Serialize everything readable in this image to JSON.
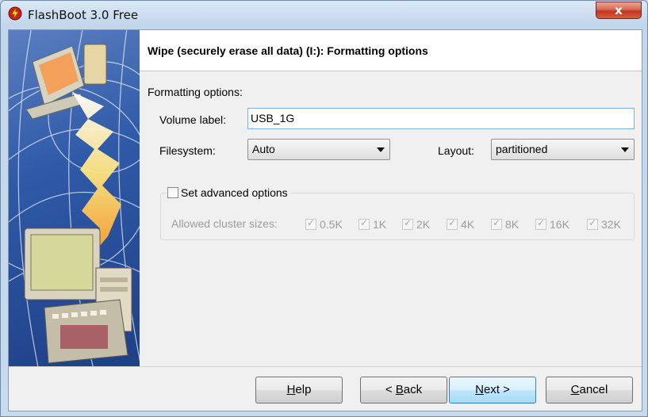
{
  "window": {
    "title": "FlashBoot 3.0 Free",
    "close_glyph": "x"
  },
  "header": {
    "title": "Wipe (securely erase all data) (I:): Formatting options"
  },
  "form": {
    "section_label": "Formatting options:",
    "volume_label": {
      "label": "Volume label:",
      "value": "USB_1G"
    },
    "filesystem": {
      "label": "Filesystem:",
      "selected": "Auto"
    },
    "layout": {
      "label": "Layout:",
      "selected": "partitioned"
    },
    "advanced": {
      "label": "Set advanced options",
      "checked": false,
      "cluster_label": "Allowed cluster sizes:",
      "clusters": [
        {
          "label": "0.5K",
          "checked": true
        },
        {
          "label": "1K",
          "checked": true
        },
        {
          "label": "2K",
          "checked": true
        },
        {
          "label": "4K",
          "checked": true
        },
        {
          "label": "8K",
          "checked": true
        },
        {
          "label": "16K",
          "checked": true
        },
        {
          "label": "32K",
          "checked": true
        }
      ]
    }
  },
  "buttons": {
    "help": {
      "pre": "",
      "key": "H",
      "post": "elp"
    },
    "back": {
      "pre": "< ",
      "key": "B",
      "post": "ack"
    },
    "next": {
      "pre": "",
      "key": "N",
      "post": "ext >"
    },
    "cancel": {
      "pre": "",
      "key": "C",
      "post": "ancel"
    }
  },
  "colors": {
    "accent_blue": "#3c7fb1",
    "close_red": "#c1361f",
    "disabled_text": "#9c9c9c"
  }
}
